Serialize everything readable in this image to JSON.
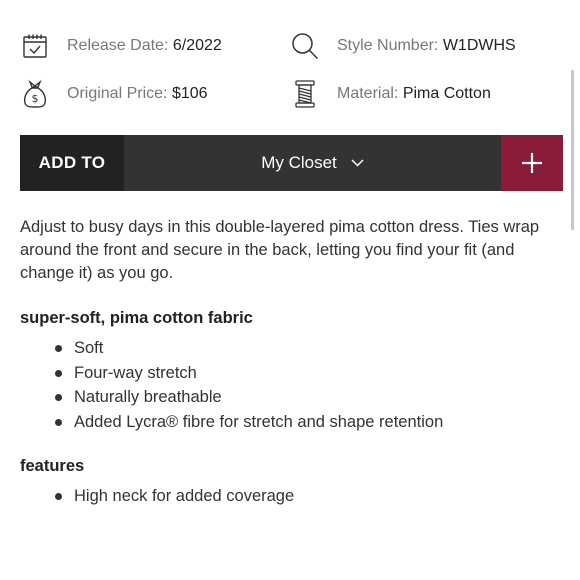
{
  "meta": {
    "release_label": "Release Date:",
    "release_value": "6/2022",
    "style_label": "Style Number:",
    "style_value": "W1DWHS",
    "price_label": "Original Price:",
    "price_value": "$106",
    "material_label": "Material:",
    "material_value": "Pima Cotton",
    "icons": [
      "calendar-icon",
      "search-icon",
      "money-bag-icon",
      "thread-spool-icon"
    ]
  },
  "add_bar": {
    "add_to_label": "ADD TO",
    "closet_label": "My Closet",
    "plus_label": "+",
    "accent_color": "#8a1c3a"
  },
  "description": "Adjust to busy days in this double-layered pima cotton dress. Ties wrap around the front and secure in the back, letting you find your fit (and change it) as you go.",
  "sections": [
    {
      "title": "super-soft, pima cotton fabric",
      "items": [
        "Soft",
        "Four-way stretch",
        "Naturally breathable",
        "Added Lycra® fibre for stretch and shape retention"
      ]
    },
    {
      "title": "features",
      "items": [
        "High neck for added coverage"
      ]
    }
  ]
}
